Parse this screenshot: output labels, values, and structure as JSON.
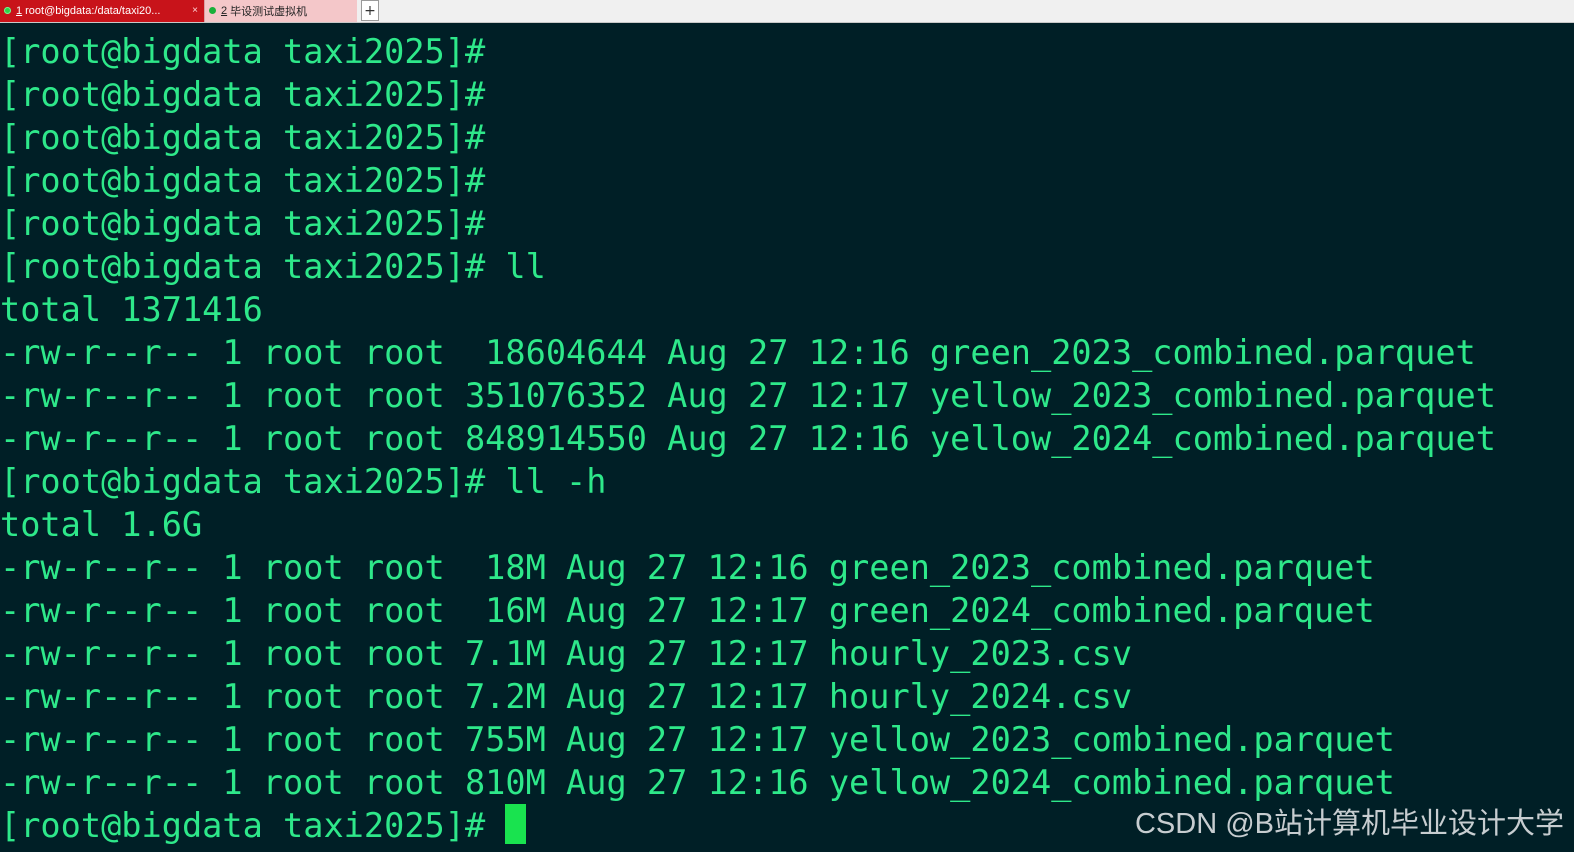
{
  "tabs": [
    {
      "number": "1",
      "label": "root@bigdata:/data/taxi20...",
      "close": "×",
      "active": true,
      "status_color": "#2fd34a"
    },
    {
      "number": "2",
      "label": "毕设测试虚拟机",
      "active": false,
      "status_color": "#19b03a"
    }
  ],
  "tab_add_label": "+",
  "terminal": {
    "foreground": "#2ee88a",
    "background": "#001f26",
    "cursor_color": "#19e34f",
    "lines": [
      "[root@bigdata taxi2025]#",
      "[root@bigdata taxi2025]#",
      "[root@bigdata taxi2025]#",
      "[root@bigdata taxi2025]#",
      "[root@bigdata taxi2025]#",
      "[root@bigdata taxi2025]# ll",
      "total 1371416",
      "-rw-r--r-- 1 root root  18604644 Aug 27 12:16 green_2023_combined.parquet",
      "-rw-r--r-- 1 root root 351076352 Aug 27 12:17 yellow_2023_combined.parquet",
      "-rw-r--r-- 1 root root 848914550 Aug 27 12:16 yellow_2024_combined.parquet",
      "[root@bigdata taxi2025]# ll -h",
      "total 1.6G",
      "-rw-r--r-- 1 root root  18M Aug 27 12:16 green_2023_combined.parquet",
      "-rw-r--r-- 1 root root  16M Aug 27 12:17 green_2024_combined.parquet",
      "-rw-r--r-- 1 root root 7.1M Aug 27 12:17 hourly_2023.csv",
      "-rw-r--r-- 1 root root 7.2M Aug 27 12:17 hourly_2024.csv",
      "-rw-r--r-- 1 root root 755M Aug 27 12:17 yellow_2023_combined.parquet",
      "-rw-r--r-- 1 root root 810M Aug 27 12:16 yellow_2024_combined.parquet"
    ],
    "prompt": "[root@bigdata taxi2025]# "
  },
  "watermark": "CSDN @B站计算机毕业设计大学"
}
